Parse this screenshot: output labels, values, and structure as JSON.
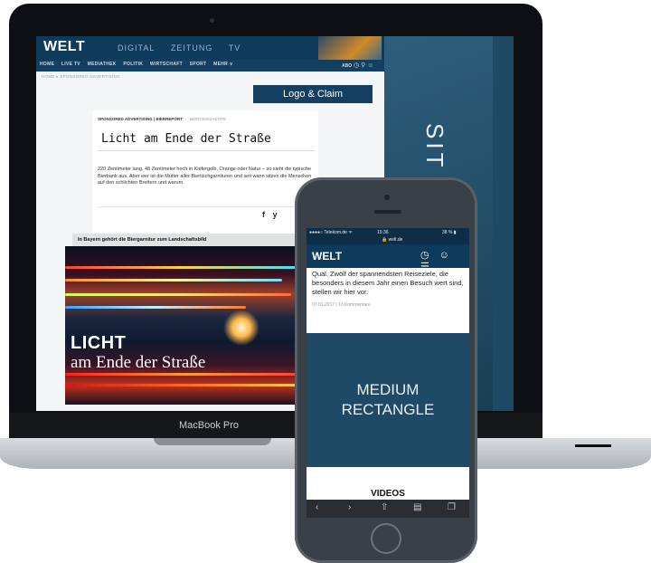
{
  "laptop": {
    "model_label": "MacBook Pro",
    "site": {
      "logo": "WELT",
      "top_nav": [
        "DIGITAL",
        "ZEITUNG",
        "TV"
      ],
      "sub_nav": [
        "HOME",
        "LIVE TV",
        "MEDIATHEK",
        "POLITIK",
        "WIRTSCHAFT",
        "SPORT",
        "MEHR ∨"
      ],
      "sub_nav_right": "ABO",
      "breadcrumb": "HOME ▸ SPONSORED ADVERTISING",
      "logo_claim": "Logo & Claim",
      "side_panel_text": "SIT",
      "article": {
        "kicker": "SPONSORED ADVERTISING | BIERREPORT",
        "kicker_secondary": "BIERGESCHICHTE",
        "title": "Licht am Ende der Straße",
        "body": "220 Zentimeter lang, 48 Zentimeter hoch in Kiefergelb, Orange oder Natur – so sieht die typische Bierbank aus. Aber wer ist die Mutter aller Biertischgarnituren und seit wann sitzen die Menschen auf den schlichten Brettern und warum."
      },
      "share": [
        "f",
        "y"
      ],
      "image_caption": "In Bayern gehört die Biergarnitur zum Landschaftsbild",
      "hero": {
        "title": "LICHT",
        "subtitle": "am Ende der Straße"
      }
    }
  },
  "phone": {
    "status": {
      "carrier": "●●●●○ Telekom.de ᯤ",
      "time": "15:36",
      "url": "🔒 welt.de",
      "battery": "38 % ▮"
    },
    "logo": "WELT",
    "text": "Qual. Zwölf der spannendsten Reiseziele, die besonders in diesem Jahr einen Besuch wert sind, stellen wir hier vor.",
    "meta": "07.01.2017 | 13 Kommentare",
    "ad_label_line1": "MEDIUM",
    "ad_label_line2": "RECTANGLE",
    "videos_label": "VIDEOS"
  },
  "colors": {
    "brand_dark_blue": "#0e3a5c",
    "ad_blue": "#1f4a66"
  }
}
